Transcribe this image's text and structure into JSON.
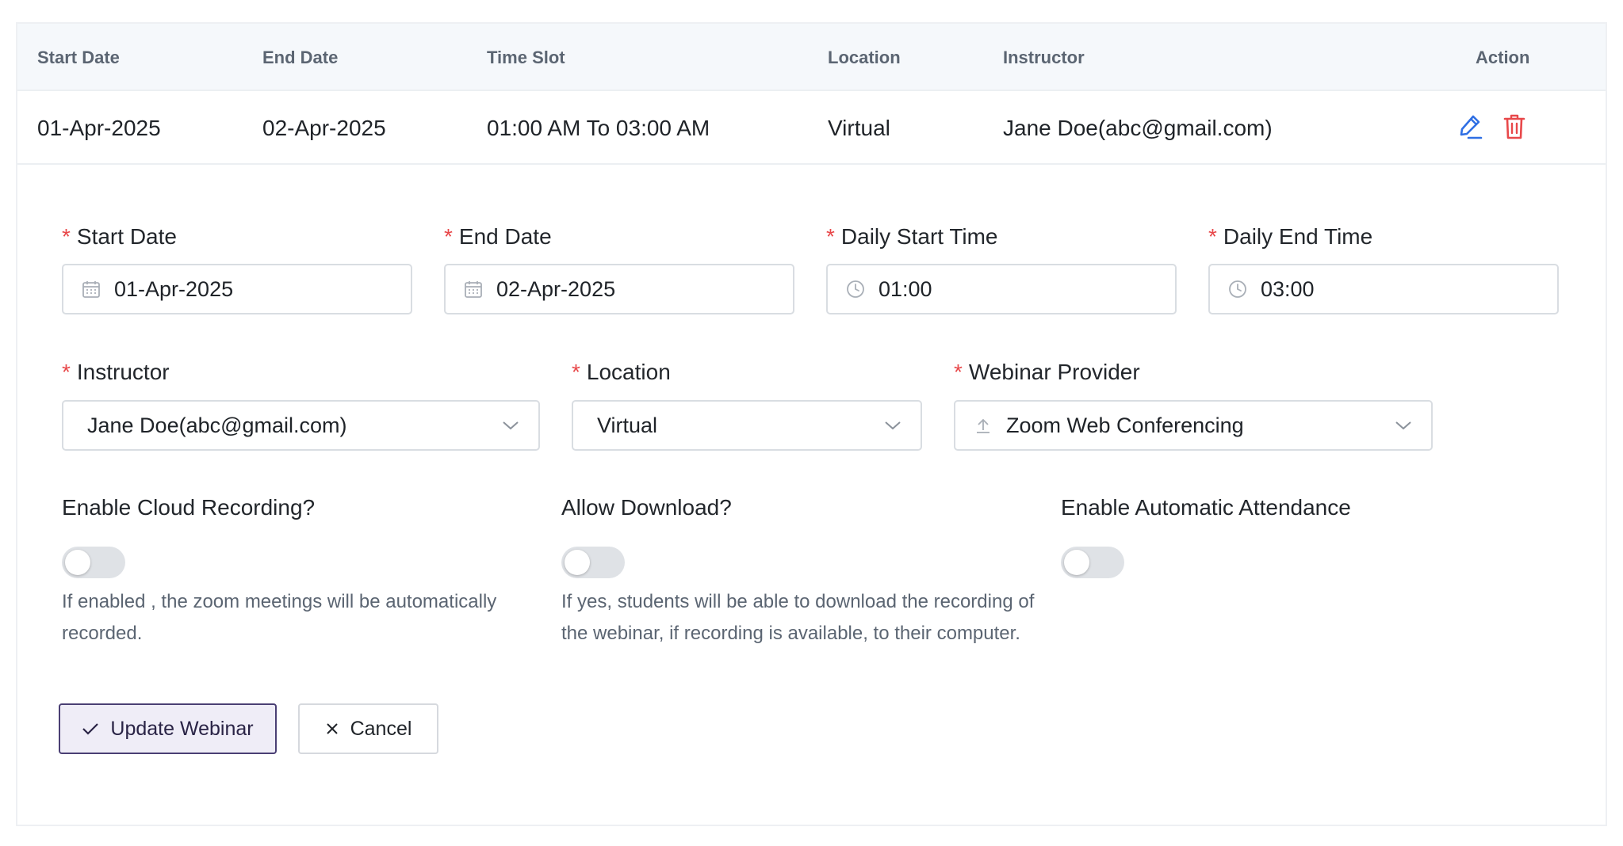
{
  "table": {
    "headers": {
      "start_date": "Start Date",
      "end_date": "End Date",
      "time_slot": "Time Slot",
      "location": "Location",
      "instructor": "Instructor",
      "action": "Action"
    },
    "row": {
      "start_date": "01-Apr-2025",
      "end_date": "02-Apr-2025",
      "time_slot": "01:00 AM To 03:00 AM",
      "location": "Virtual",
      "instructor": "Jane Doe(abc@gmail.com)",
      "actions": [
        "edit-icon",
        "trash-icon"
      ]
    }
  },
  "form": {
    "required_mark": "*",
    "start_date": {
      "label": "Start Date",
      "value": "01-Apr-2025",
      "icon": "calendar-icon"
    },
    "end_date": {
      "label": "End Date",
      "value": "02-Apr-2025",
      "icon": "calendar-icon"
    },
    "daily_start_time": {
      "label": "Daily Start Time",
      "value": "01:00",
      "icon": "clock-icon"
    },
    "daily_end_time": {
      "label": "Daily End Time",
      "value": "03:00",
      "icon": "clock-icon"
    },
    "instructor": {
      "label": "Instructor",
      "value": "Jane Doe(abc@gmail.com)"
    },
    "location": {
      "label": "Location",
      "value": "Virtual"
    },
    "webinar_provider": {
      "label": "Webinar Provider",
      "value": "Zoom Web Conferencing",
      "icon": "upload-icon"
    },
    "cloud_recording": {
      "label": "Enable Cloud Recording?",
      "enabled": false,
      "help": "If enabled , the zoom meetings will be automatically recorded."
    },
    "allow_download": {
      "label": "Allow Download?",
      "enabled": false,
      "help": "If yes, students will be able to download the recording of the webinar, if recording is available, to their computer."
    },
    "auto_attendance": {
      "label": "Enable Automatic Attendance",
      "enabled": false
    }
  },
  "buttons": {
    "update": "Update Webinar",
    "cancel": "Cancel"
  },
  "colors": {
    "required": "#e8484a",
    "edit_icon": "#2f6fe4",
    "delete_icon": "#e8484a",
    "primary_border": "#4a3f74",
    "toggle_off": "#dfe2e6"
  }
}
